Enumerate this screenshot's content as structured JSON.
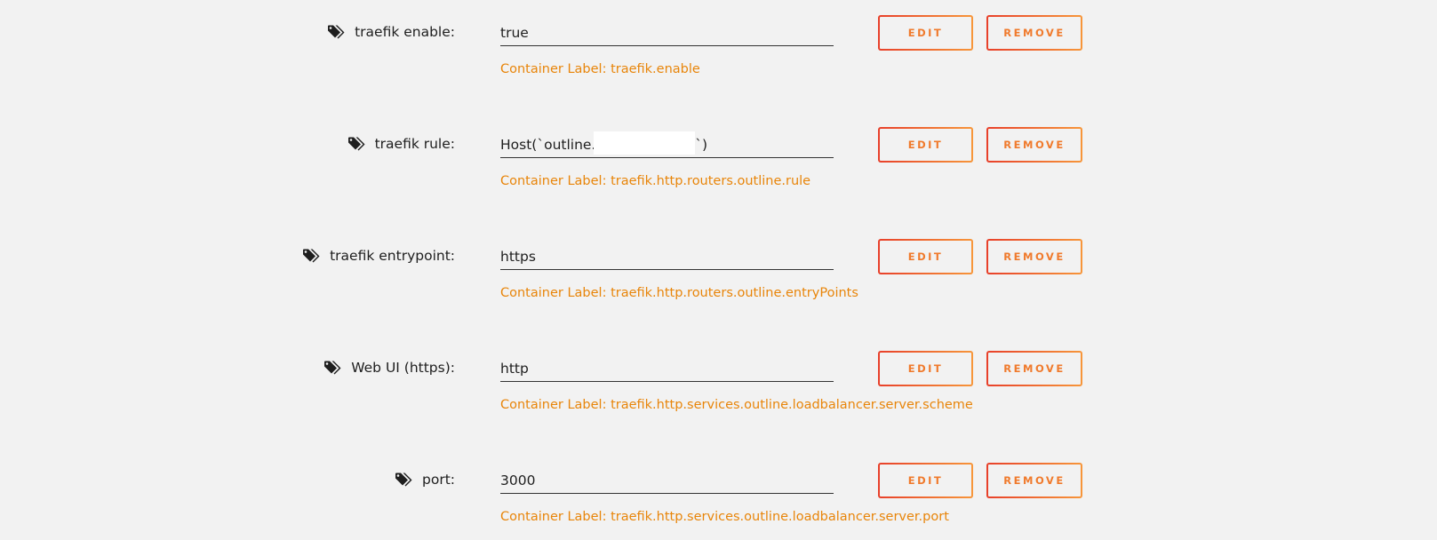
{
  "icons": {
    "label_icon": "tags-icon"
  },
  "colors": {
    "hint": "#e8850a",
    "button_text": "#f07a2c",
    "button_border_start": "#e8402a",
    "button_border_end": "#f7963a",
    "background": "#f2f2f2"
  },
  "buttons": {
    "edit_label": "EDIT",
    "remove_label": "REMOVE"
  },
  "fields": [
    {
      "label": "traefik enable:",
      "value": "true",
      "hint": "Container Label: traefik.enable"
    },
    {
      "label": "traefik rule:",
      "value": "Host(`outline.               .com`)",
      "hint": "Container Label: traefik.http.routers.outline.rule"
    },
    {
      "label": "traefik entrypoint:",
      "value": "https",
      "hint": "Container Label: traefik.http.routers.outline.entryPoints"
    },
    {
      "label": "Web UI (https):",
      "value": "http",
      "hint": "Container Label: traefik.http.services.outline.loadbalancer.server.scheme"
    },
    {
      "label": "port:",
      "value": "3000",
      "hint": "Container Label: traefik.http.services.outline.loadbalancer.server.port"
    }
  ]
}
